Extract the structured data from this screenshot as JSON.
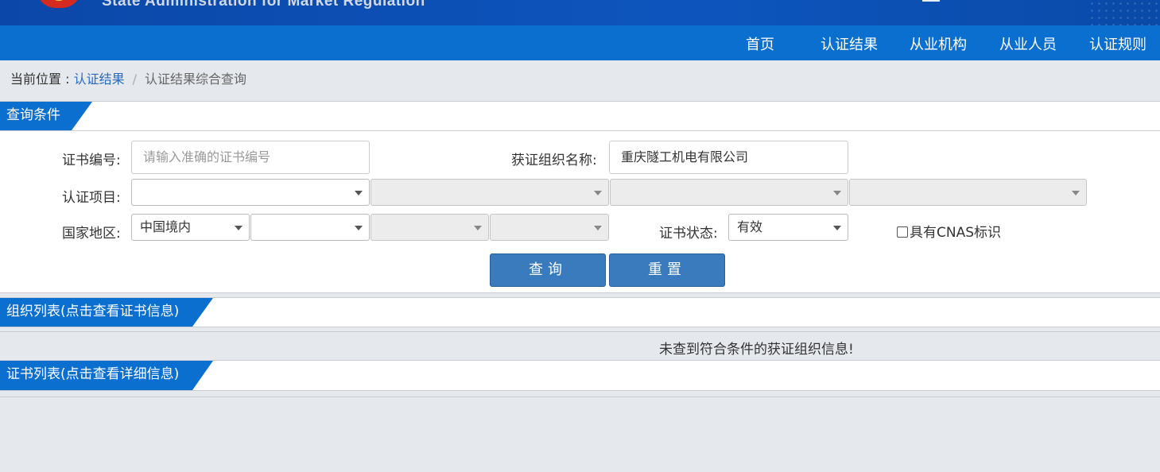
{
  "banner": {
    "title_en": "State Administration  for  Market Regulation"
  },
  "nav": {
    "items": [
      "首页",
      "认证结果",
      "从业机构",
      "从业人员",
      "认证规则"
    ]
  },
  "breadcrumb": {
    "prefix": "当前位置 : ",
    "link": "认证结果",
    "separator": "/",
    "current": "认证结果综合查询"
  },
  "query_panel": {
    "title": "查询条件",
    "cert_no": {
      "label": "证书编号:",
      "placeholder": "请输入准确的证书编号",
      "value": ""
    },
    "org_name": {
      "label": "获证组织名称:",
      "value": "重庆隧工机电有限公司"
    },
    "cert_item": {
      "label": "认证项目:",
      "selects": [
        "",
        "",
        "",
        ""
      ]
    },
    "region": {
      "label": "国家地区:",
      "selects": [
        "中国境内",
        "",
        "",
        ""
      ]
    },
    "cert_status": {
      "label": "证书状态:",
      "value": "有效"
    },
    "cnas": {
      "label": "具有CNAS标识",
      "checked": false
    },
    "search_button": "查询",
    "reset_button": "重置"
  },
  "org_list": {
    "title": "组织列表(点击查看证书信息)",
    "empty_message": "未查到符合条件的获证组织信息!"
  },
  "cert_list": {
    "title": "证书列表(点击查看详细信息)"
  },
  "colors": {
    "nav_blue": "#0b6fd0",
    "button_blue": "#3a7bbd",
    "link_blue": "#2a6bb8",
    "page_gray": "#e5e8ec"
  }
}
